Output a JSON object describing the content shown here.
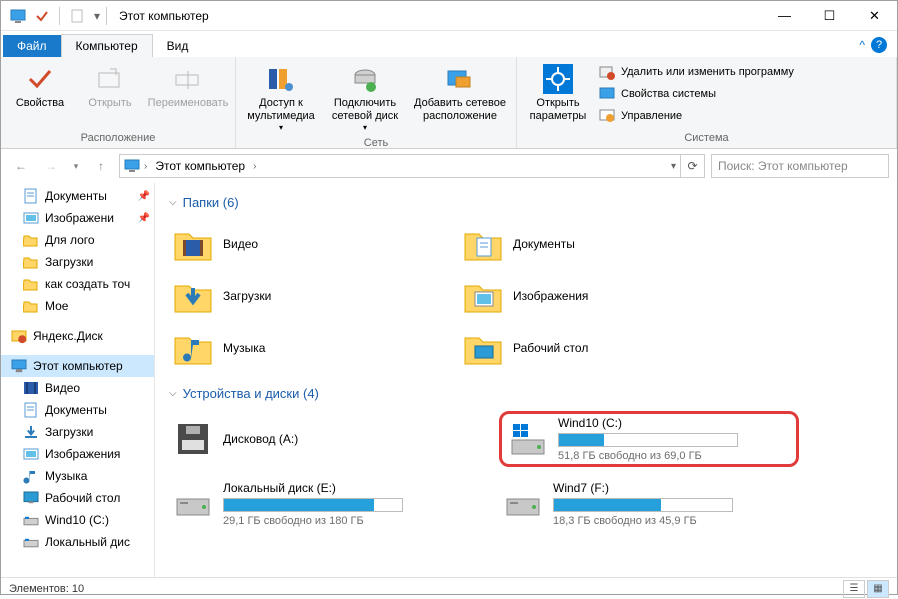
{
  "title": "Этот компьютер",
  "tabs": {
    "file": "Файл",
    "computer": "Компьютер",
    "view": "Вид"
  },
  "ribbon": {
    "location": {
      "label": "Расположение",
      "properties": "Свойства",
      "open": "Открыть",
      "rename": "Переименовать"
    },
    "network": {
      "label": "Сеть",
      "multimedia": "Доступ к мультимедиа",
      "mapdrive": "Подключить сетевой диск",
      "addlocation": "Добавить сетевое расположение"
    },
    "system": {
      "label": "Система",
      "settings": "Открыть параметры",
      "uninstall": "Удалить или изменить программу",
      "sysprops": "Свойства системы",
      "manage": "Управление"
    }
  },
  "breadcrumb": {
    "root": "Этот компьютер"
  },
  "search": {
    "placeholder": "Поиск: Этот компьютер"
  },
  "sidebar": [
    {
      "label": "Документы",
      "icon": "doc",
      "pinned": true
    },
    {
      "label": "Изображени",
      "icon": "img",
      "pinned": true
    },
    {
      "label": "Для лого",
      "icon": "folder",
      "pinned": false
    },
    {
      "label": "Загрузки",
      "icon": "folder",
      "pinned": false
    },
    {
      "label": "как создать точ",
      "icon": "folder",
      "pinned": false
    },
    {
      "label": "Мое",
      "icon": "folder",
      "pinned": false
    },
    {
      "label": "Яндекс.Диск",
      "icon": "yadisk",
      "pinned": false,
      "top": true
    },
    {
      "label": "Этот компьютер",
      "icon": "pc",
      "pinned": false,
      "selected": true,
      "top": true
    },
    {
      "label": "Видео",
      "icon": "video",
      "pinned": false
    },
    {
      "label": "Документы",
      "icon": "doc",
      "pinned": false
    },
    {
      "label": "Загрузки",
      "icon": "download",
      "pinned": false
    },
    {
      "label": "Изображения",
      "icon": "img",
      "pinned": false
    },
    {
      "label": "Музыка",
      "icon": "music",
      "pinned": false
    },
    {
      "label": "Рабочий стол",
      "icon": "desktop",
      "pinned": false
    },
    {
      "label": "Wind10 (C:)",
      "icon": "drive",
      "pinned": false
    },
    {
      "label": "Локальный дис",
      "icon": "drive",
      "pinned": false
    }
  ],
  "groups": {
    "folders": {
      "title": "Папки (6)"
    },
    "drives": {
      "title": "Устройства и диски (4)"
    }
  },
  "folders": [
    {
      "label": "Видео",
      "icon": "video"
    },
    {
      "label": "Документы",
      "icon": "doc"
    },
    {
      "label": "Загрузки",
      "icon": "download"
    },
    {
      "label": "Изображения",
      "icon": "img"
    },
    {
      "label": "Музыка",
      "icon": "music"
    },
    {
      "label": "Рабочий стол",
      "icon": "desktop"
    }
  ],
  "drives": [
    {
      "name": "Дисковод (A:)",
      "type": "floppy",
      "free": "",
      "fillpct": 0
    },
    {
      "name": "Wind10 (C:)",
      "type": "os",
      "free": "51,8 ГБ свободно из 69,0 ГБ",
      "fillpct": 25,
      "highlighted": true
    },
    {
      "name": "Локальный диск (E:)",
      "type": "hdd",
      "free": "29,1 ГБ свободно из 180 ГБ",
      "fillpct": 84
    },
    {
      "name": "Wind7 (F:)",
      "type": "hdd",
      "free": "18,3 ГБ свободно из 45,9 ГБ",
      "fillpct": 60
    }
  ],
  "status": {
    "items": "Элементов: 10"
  }
}
